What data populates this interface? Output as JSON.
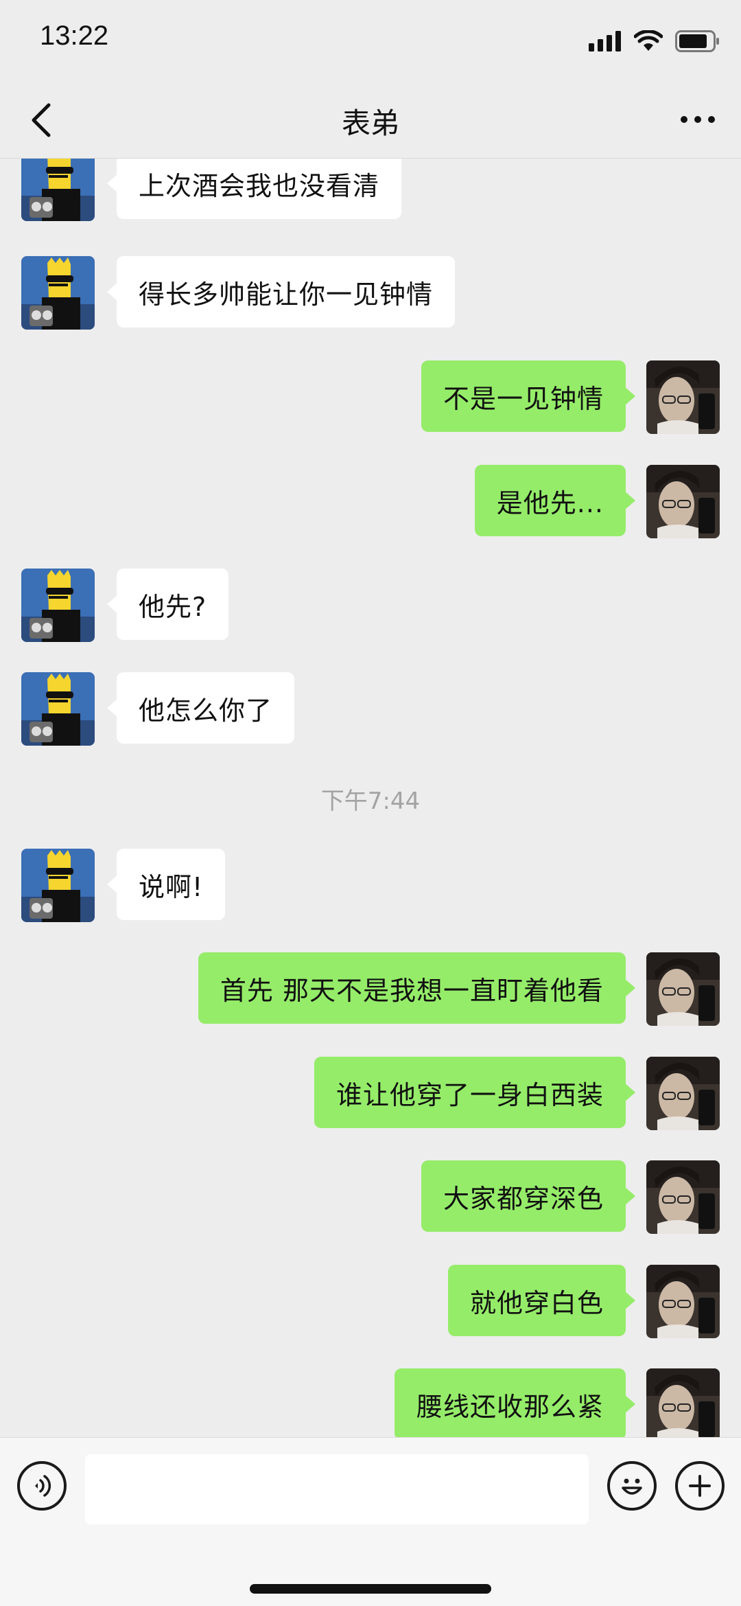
{
  "status": {
    "time": "13:22"
  },
  "header": {
    "title": "表弟"
  },
  "colors": {
    "outgoing_bubble": "#95ec69",
    "incoming_bubble": "#ffffff",
    "background": "#ededed"
  },
  "messages": [
    {
      "side": "left",
      "text": "上次酒会我也没看清"
    },
    {
      "side": "left",
      "text": "得长多帅能让你一见钟情"
    },
    {
      "side": "right",
      "text": "不是一见钟情"
    },
    {
      "side": "right",
      "text": "是他先..."
    },
    {
      "side": "left",
      "text": "他先?"
    },
    {
      "side": "left",
      "text": "他怎么你了"
    },
    {
      "timestamp": "下午7:44"
    },
    {
      "side": "left",
      "text": "说啊!"
    },
    {
      "side": "right",
      "text": "首先 那天不是我想一直盯着他看"
    },
    {
      "side": "right",
      "text": "谁让他穿了一身白西装"
    },
    {
      "side": "right",
      "text": "大家都穿深色"
    },
    {
      "side": "right",
      "text": "就他穿白色"
    },
    {
      "side": "right",
      "text": "腰线还收那么紧"
    }
  ],
  "input": {
    "value": "",
    "placeholder": ""
  },
  "icons": {
    "back": "chevron-left-icon",
    "more": "more-dots-icon",
    "voice": "voice-icon",
    "emoji": "emoji-icon",
    "plus": "plus-icon"
  }
}
